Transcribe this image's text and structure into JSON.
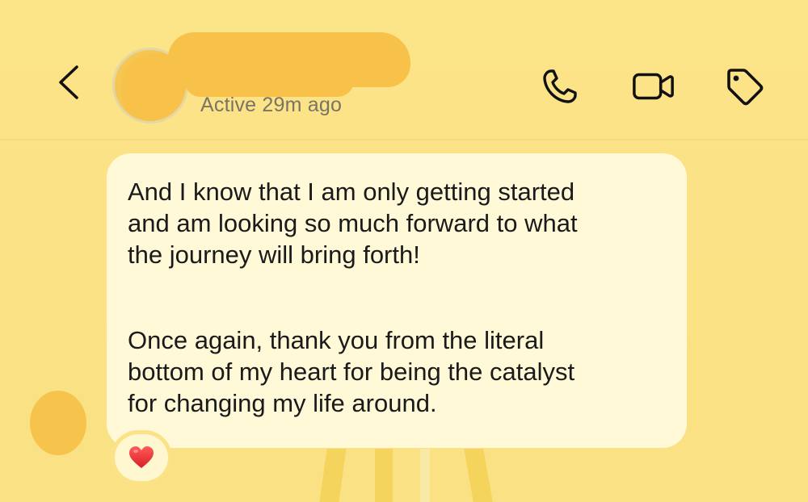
{
  "header": {
    "contact_name": "",
    "status": "Active 29m ago",
    "icons": {
      "back": "chevron-left-icon",
      "call": "phone-icon",
      "video": "video-camera-icon",
      "tag": "tag-icon"
    }
  },
  "message": {
    "paragraphs": [
      "And I know that I am only getting started\nand am looking so much forward to what\nthe journey will bring forth!",
      "Once again, thank you from the literal\nbottom of my heart for being the catalyst\nfor changing my life around."
    ],
    "reaction": "❤️"
  },
  "colors": {
    "background": "#fbe286",
    "bubble": "#fff9d7",
    "redaction": "#f8c24a",
    "text": "#1a1a1a",
    "status_text": "#7a7462"
  }
}
